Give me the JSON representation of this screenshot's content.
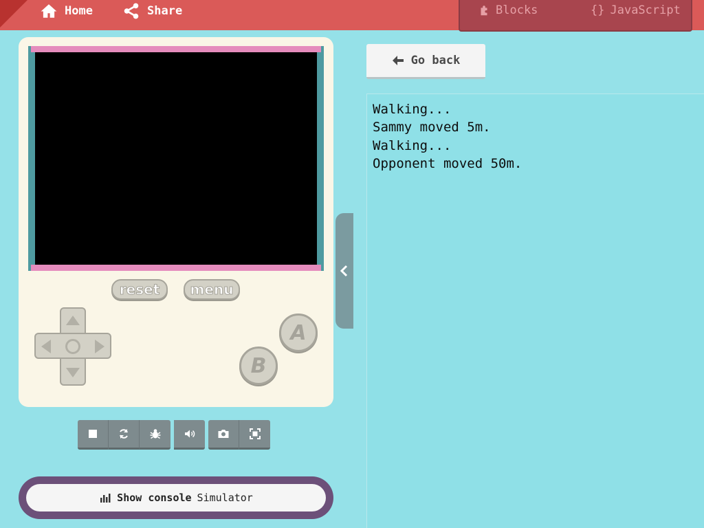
{
  "nav": {
    "home_label": "Home",
    "share_label": "Share",
    "blocks_label": "Blocks",
    "javascript_label": "JavaScript",
    "javascript_prefix": "{}"
  },
  "simulator": {
    "reset_label": "reset",
    "menu_label": "menu",
    "a_label": "A",
    "b_label": "B"
  },
  "toolbar": {
    "icons": [
      "stop-icon",
      "restart-icon",
      "debug-icon",
      "sound-icon",
      "screenshot-icon",
      "fullscreen-icon"
    ]
  },
  "console_toggle": {
    "bold_label": "Show console",
    "sub_label": "Simulator"
  },
  "go_back_label": "Go back",
  "console": {
    "lines": [
      "Walking...",
      "Sammy moved 5m.",
      "Walking...",
      "Opponent moved 50m."
    ]
  },
  "colors": {
    "topbar": "#da5a58",
    "background": "#95e1e8",
    "device": "#faf6e7",
    "screen_border": "#e58cbd"
  }
}
